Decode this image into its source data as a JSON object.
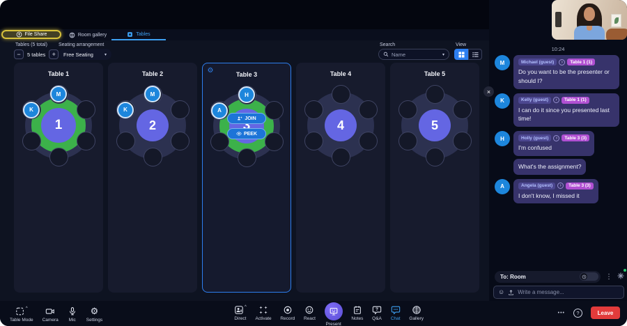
{
  "tabs": {
    "file_share": "File Share",
    "room_gallery": "Room gallery",
    "tables": "Tables"
  },
  "controls": {
    "tables_total_label": "Tables (5 total)",
    "tables_count": "5 tables",
    "seating_label": "Seating arrangement",
    "seating_value": "Free Seating",
    "search_label": "Search",
    "search_placeholder": "Name",
    "view_label": "View"
  },
  "tables": [
    {
      "title": "Table 1",
      "number": "1",
      "green": true,
      "occupants": [
        {
          "initial": "M"
        },
        {
          "initial": "K"
        }
      ]
    },
    {
      "title": "Table 2",
      "number": "2",
      "green": false,
      "occupants": [
        {
          "initial": "M"
        },
        {
          "initial": "K"
        }
      ]
    },
    {
      "title": "Table 3",
      "number": "3",
      "green": true,
      "selected": true,
      "occupants": [
        {
          "initial": "H"
        },
        {
          "initial": "A"
        }
      ],
      "join_label": "JOIN",
      "peek_label": "PEEK"
    },
    {
      "title": "Table 4",
      "number": "4",
      "green": false,
      "occupants": []
    },
    {
      "title": "Table 5",
      "number": "5",
      "green": false,
      "occupants": []
    }
  ],
  "chat": {
    "timestamp": "10:24",
    "messages": [
      {
        "initial": "M",
        "name": "Michael (guest)",
        "table_tag": "Table 1 (1)",
        "text": "Do you want to be the presenter or should I?"
      },
      {
        "initial": "K",
        "name": "Kelly (guest)",
        "table_tag": "Table 1 (1)",
        "text": "I can do it since you presented last time!"
      },
      {
        "initial": "H",
        "name": "Holly (guest)",
        "table_tag": "Table 3 (3)",
        "text": "I'm confused",
        "text2": "What's the assignment?"
      },
      {
        "initial": "A",
        "name": "Angela (guest)",
        "table_tag": "Table 3 (3)",
        "text": "I don't know, I missed it"
      }
    ],
    "to_label": "To: Room",
    "input_placeholder": "Write a message..."
  },
  "toolbar": {
    "left": [
      {
        "label": "Table Mode"
      },
      {
        "label": "Camera"
      },
      {
        "label": "Mic"
      },
      {
        "label": "Settings"
      }
    ],
    "center": [
      {
        "label": "Direct"
      },
      {
        "label": "Activate"
      },
      {
        "label": "Record"
      },
      {
        "label": "React"
      },
      {
        "label": "Present"
      },
      {
        "label": "Notes"
      },
      {
        "label": "Q&A"
      },
      {
        "label": "Chat"
      },
      {
        "label": "Gallery"
      }
    ],
    "leave_label": "Leave"
  },
  "icons": {
    "minus": "−",
    "plus": "+",
    "chevron_down": "▾",
    "caret_up": "^",
    "dots_vertical": "⋮",
    "dots_horizontal": "•••",
    "help": "?",
    "close": "×",
    "emoji": "☺",
    "arrow": "›",
    "gear": "⚙"
  },
  "colors": {
    "accent_blue": "#2d7ff0",
    "active_blue": "#3da0f2",
    "green": "#3cb14a",
    "purple": "#6466e3",
    "magenta": "#b050d2",
    "red": "#e23b3b",
    "highlight_yellow": "#d8c23c"
  }
}
